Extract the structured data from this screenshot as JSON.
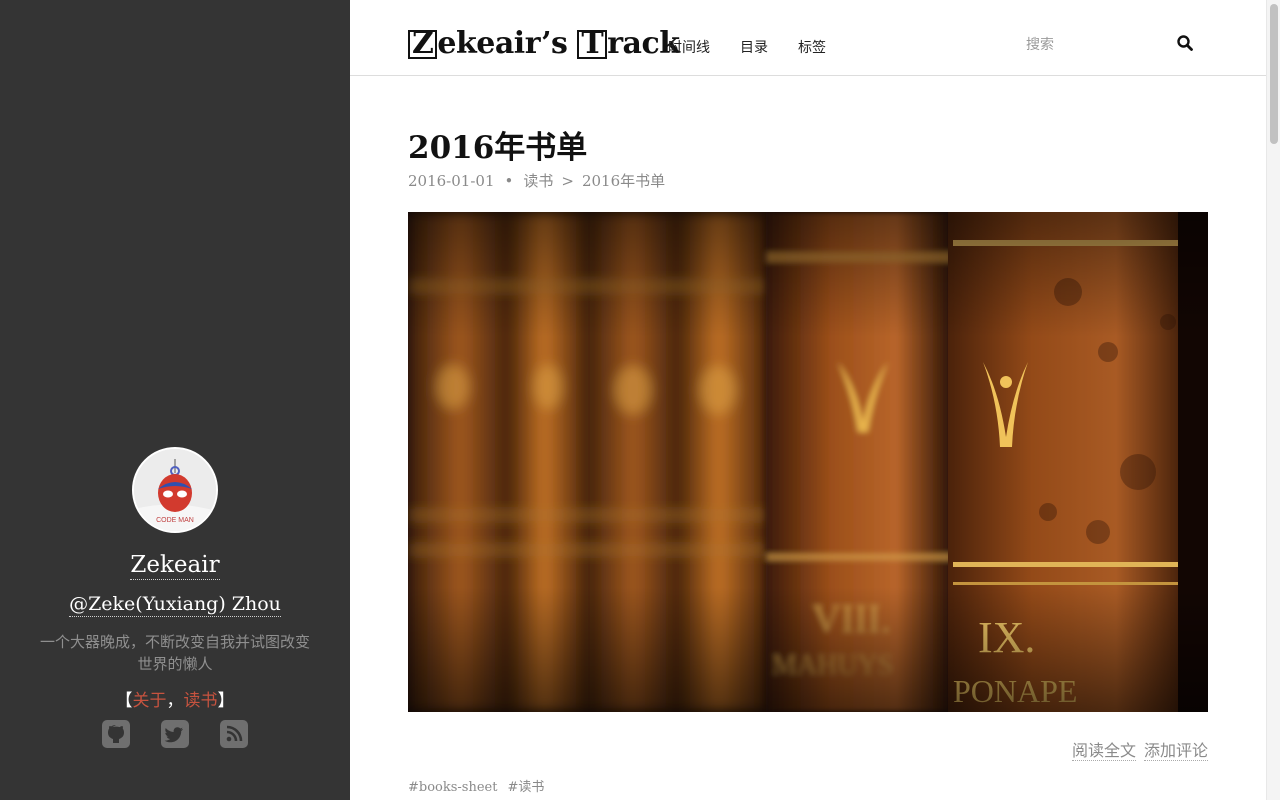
{
  "sidebar": {
    "name": "Zekeair",
    "handle": "@Zeke(Yuxiang) Zhou",
    "motto": "一个大器晚成，不断改变自我并试图改变世界的懒人",
    "links": {
      "open_bracket": "【",
      "about": "关于",
      "comma": "，",
      "reading": "读书",
      "close_bracket": "】"
    },
    "social_icons": [
      "github-icon",
      "twitter-icon",
      "rss-icon"
    ]
  },
  "header": {
    "logo_first_letter": "Z",
    "logo_mid": "ekeair’s ",
    "logo_second_letter": "T",
    "logo_end": "rack",
    "nav": [
      "时间线",
      "目录",
      "标签"
    ],
    "search_placeholder": "搜索",
    "search_icon": "search-icon"
  },
  "post": {
    "title": "2016年书单",
    "date": "2016-01-01",
    "bullet": "•",
    "category": "读书",
    "breadcrumb_sep": ">",
    "breadcrumb_current": "2016年书单",
    "actions": [
      "阅读全文",
      "添加评论"
    ],
    "tags": [
      "#books-sheet",
      "#读书"
    ]
  },
  "colors": {
    "sidebar_bg": "#343434",
    "link_accent": "#c7533f",
    "meta_gray": "#8a8a8a"
  }
}
